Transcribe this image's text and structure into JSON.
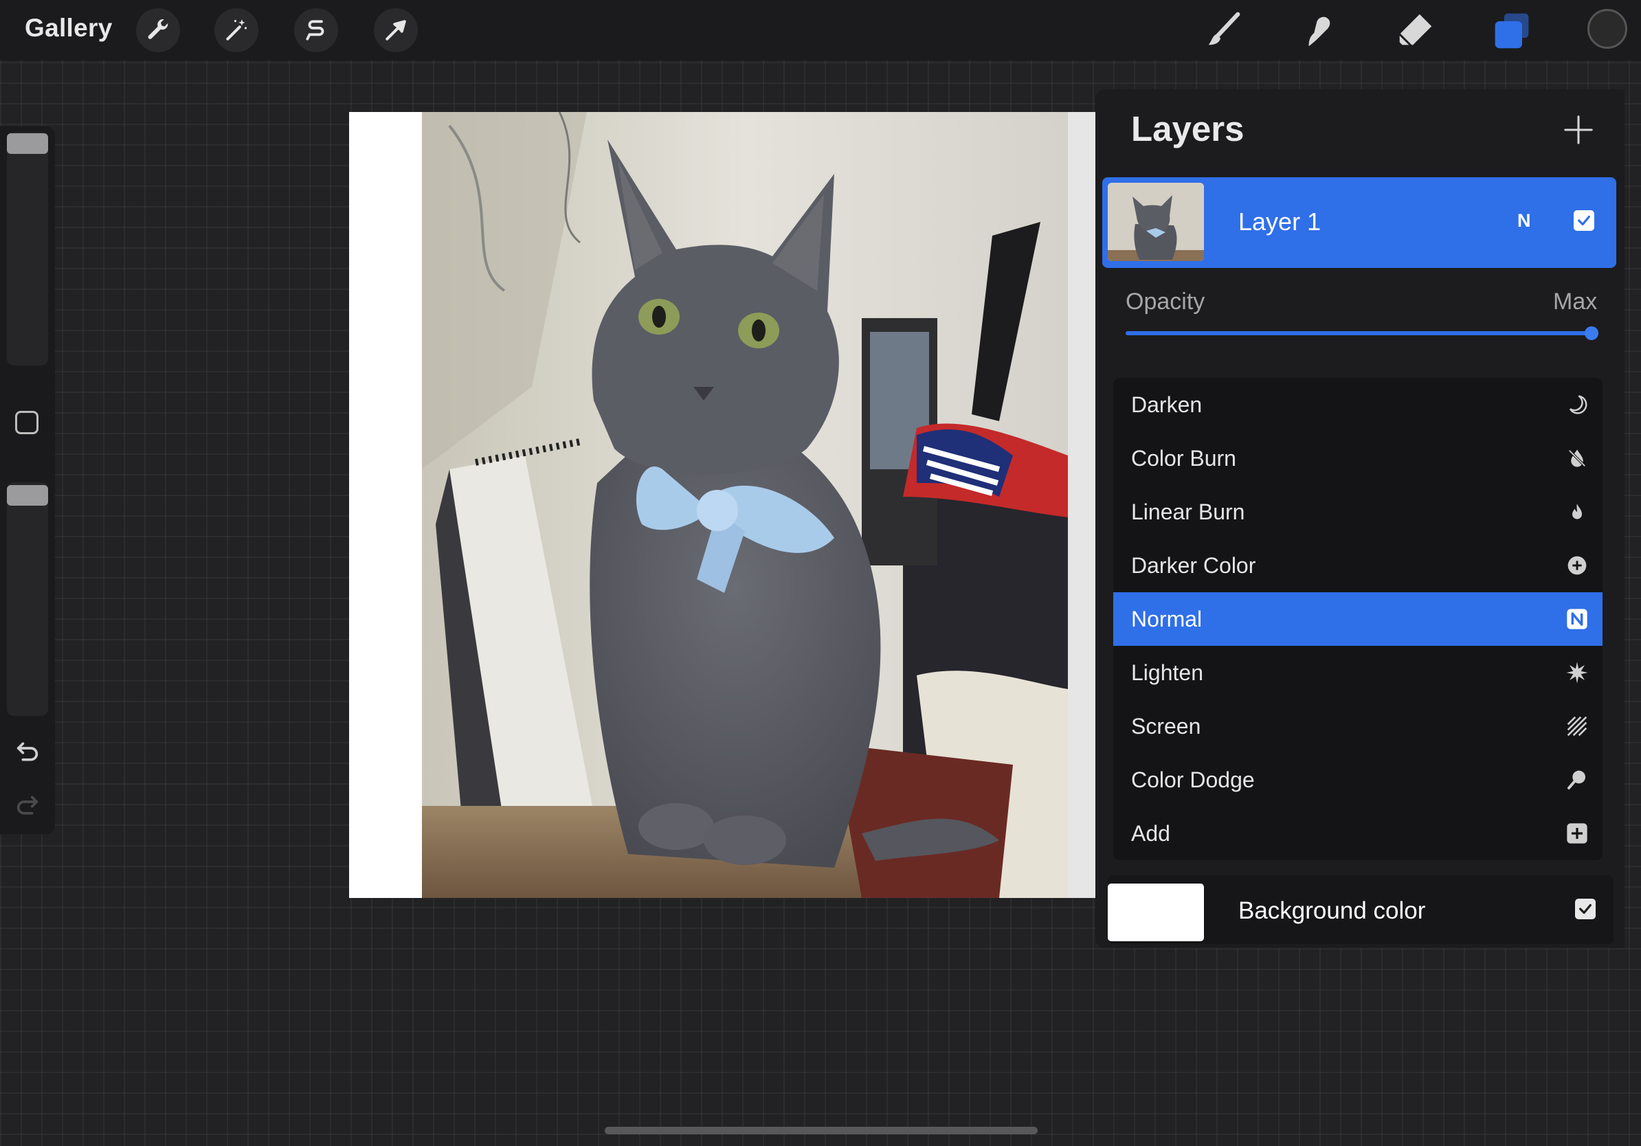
{
  "topbar": {
    "gallery_label": "Gallery",
    "left_tools": [
      "wrench-icon",
      "magic-wand-icon",
      "selection-s-icon",
      "arrow-cursor-icon"
    ],
    "right_tools": [
      "brush-icon",
      "smudge-icon",
      "eraser-icon",
      "layers-icon"
    ],
    "active_tool": "layers-icon",
    "current_color": "#2a2a2a"
  },
  "sidebar": {
    "brush_size_level": 0.02,
    "brush_opacity_level": 0.02,
    "icons": [
      "modify-square-icon",
      "undo-icon",
      "redo-icon"
    ]
  },
  "canvas": {
    "background": "#ffffff",
    "image_subject": "gray cat with light blue bow"
  },
  "layers_panel": {
    "title": "Layers",
    "add_icon": "plus-icon",
    "layer": {
      "name": "Layer 1",
      "blend_mode_badge": "N",
      "visible": true
    },
    "opacity": {
      "label": "Opacity",
      "value_label": "Max",
      "value": 1.0
    },
    "blend_modes": [
      {
        "label": "Darken",
        "icon": "moon-icon"
      },
      {
        "label": "Color Burn",
        "icon": "drop-slash-icon"
      },
      {
        "label": "Linear Burn",
        "icon": "flame-icon"
      },
      {
        "label": "Darker Color",
        "icon": "plus-circle-icon"
      },
      {
        "label": "Normal",
        "icon": "n-badge-icon",
        "active": true
      },
      {
        "label": "Lighten",
        "icon": "sun-burst-icon"
      },
      {
        "label": "Screen",
        "icon": "hatch-icon"
      },
      {
        "label": "Color Dodge",
        "icon": "magnifier-icon"
      },
      {
        "label": "Add",
        "icon": "plus-square-icon"
      }
    ],
    "background_color": {
      "label": "Background color",
      "color": "#ffffff",
      "visible": true
    },
    "accent_color": "#2f6fe8"
  }
}
